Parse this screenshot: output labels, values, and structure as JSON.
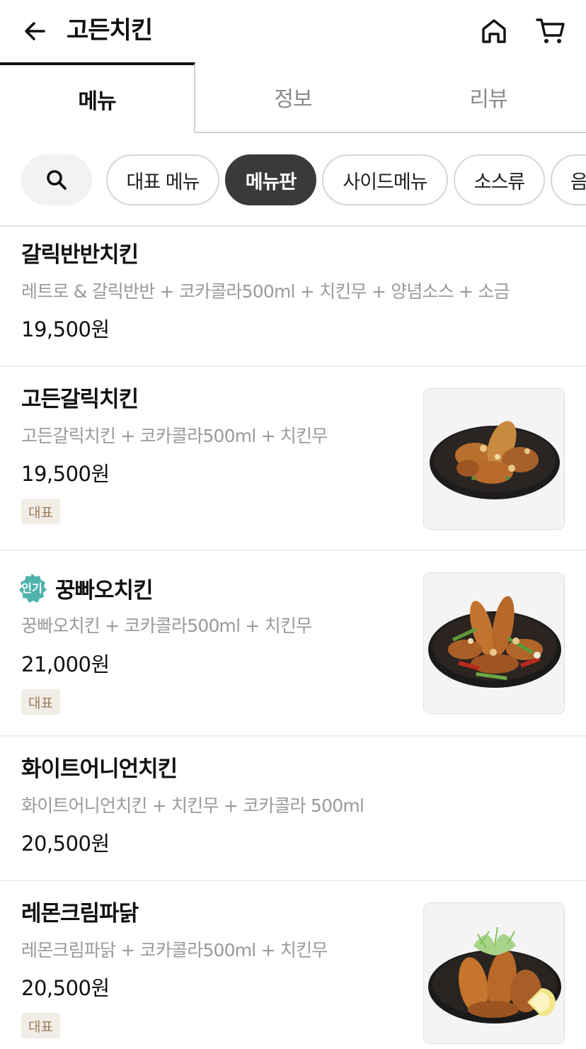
{
  "header": {
    "title": "고든치킨"
  },
  "tabs": [
    {
      "label": "메뉴",
      "active": true
    },
    {
      "label": "정보",
      "active": false
    },
    {
      "label": "리뷰",
      "active": false
    }
  ],
  "chips": [
    {
      "label": "대표 메뉴",
      "selected": false
    },
    {
      "label": "메뉴판",
      "selected": true
    },
    {
      "label": "사이드메뉴",
      "selected": false
    },
    {
      "label": "소스류",
      "selected": false
    },
    {
      "label": "음",
      "selected": false
    }
  ],
  "menu": [
    {
      "name": "갈릭반반치킨",
      "desc": "레트로 & 갈릭반반 + 코카콜라500ml + 치킨무 + 양념소스 + 소금",
      "price": "19,500원",
      "tag": "",
      "badge": "",
      "has_image": false
    },
    {
      "name": "고든갈릭치킨",
      "desc": "고든갈릭치킨 + 코카콜라500ml + 치킨무",
      "price": "19,500원",
      "tag": "대표",
      "badge": "",
      "has_image": true
    },
    {
      "name": "꿍빠오치킨",
      "desc": "꿍빠오치킨 + 코카콜라500ml + 치킨무",
      "price": "21,000원",
      "tag": "대표",
      "badge": "인기",
      "has_image": true
    },
    {
      "name": "화이트어니언치킨",
      "desc": "화이트어니언치킨 + 치킨무 + 코카콜라 500ml",
      "price": "20,500원",
      "tag": "",
      "badge": "",
      "has_image": false
    },
    {
      "name": "레몬크림파닭",
      "desc": "레몬크림파닭 + 코카콜라500ml + 치킨무",
      "price": "20,500원",
      "tag": "대표",
      "badge": "",
      "has_image": true
    }
  ],
  "colors": {
    "selected_chip_bg": "#3a3a3a",
    "tag_bg": "#f2ede6",
    "tag_text": "#9b7a5a",
    "popular_badge": "#4fb3ac"
  },
  "icons": {
    "back": "arrow-left-icon",
    "home": "home-icon",
    "cart": "cart-icon",
    "search": "search-icon"
  }
}
